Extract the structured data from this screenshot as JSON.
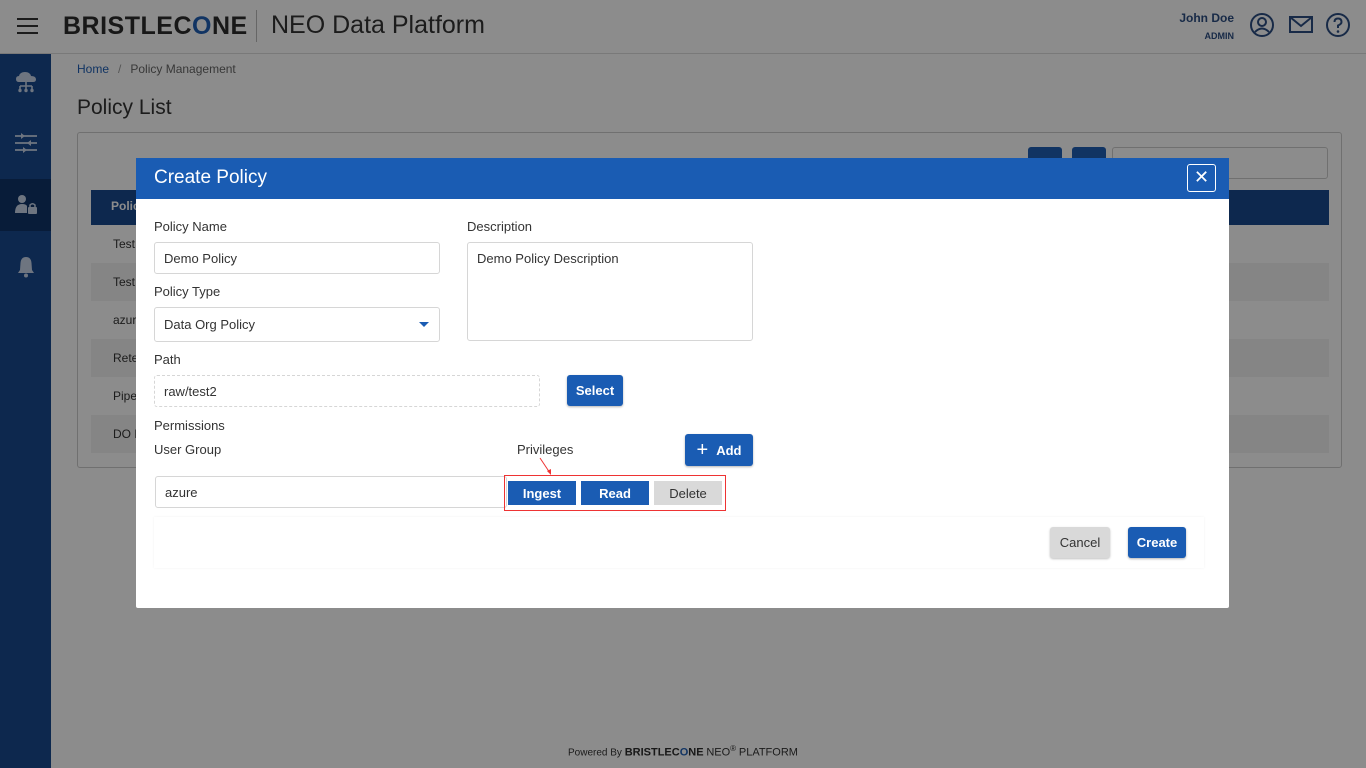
{
  "header": {
    "brand_prefix": "BRISTLEC",
    "brand_accent": "O",
    "brand_suffix": "NE",
    "app_title": "NEO Data Platform",
    "user_name": "John Doe",
    "user_role": "ADMIN",
    "icons": [
      "menu-icon",
      "account-icon",
      "mail-icon",
      "help-icon"
    ]
  },
  "sidebar": {
    "items": [
      {
        "icon": "cloud-network-icon",
        "active": false
      },
      {
        "icon": "filter-sliders-icon",
        "active": false
      },
      {
        "icon": "user-lock-icon",
        "active": true
      },
      {
        "icon": "bell-icon",
        "active": false
      }
    ]
  },
  "breadcrumb": {
    "home": "Home",
    "separator": "/",
    "current": "Policy Management"
  },
  "page": {
    "title": "Policy List",
    "table_header_fragment": "Polic",
    "rows": [
      "Test",
      "Test",
      "azur",
      "Rete",
      "Pipe",
      "DO P"
    ]
  },
  "modal": {
    "title": "Create Policy",
    "close_symbol": "✕",
    "policy_name_label": "Policy Name",
    "policy_name_value": "Demo Policy",
    "description_label": "Description",
    "description_value": "Demo Policy Description",
    "policy_type_label": "Policy Type",
    "policy_type_value": "Data Org Policy",
    "path_label": "Path",
    "path_value": "raw/test2",
    "select_button": "Select",
    "permissions_label": "Permissions",
    "user_group_label": "User Group",
    "privileges_label": "Privileges",
    "add_button": "Add",
    "add_symbol": "+",
    "user_group_value": "azure",
    "privileges": [
      {
        "label": "Ingest",
        "selected": true
      },
      {
        "label": "Read",
        "selected": true
      },
      {
        "label": "Delete",
        "selected": false
      }
    ],
    "cancel_button": "Cancel",
    "create_button": "Create"
  },
  "footer": {
    "powered_by": "Powered By",
    "brand_prefix": "BRISTLEC",
    "brand_accent": "O",
    "brand_suffix": "NE",
    "neo": "NEO",
    "registered": "®",
    "platform": "PLATFORM"
  },
  "colors": {
    "primary": "#1a5cb3",
    "sidebar": "#184a8e",
    "highlight_box": "#ee3333"
  }
}
